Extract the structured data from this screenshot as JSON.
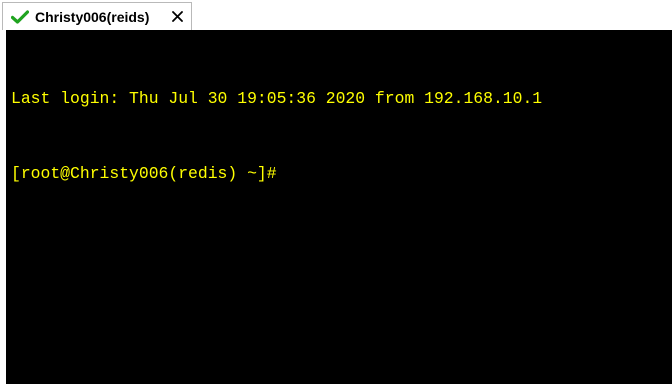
{
  "tab": {
    "title": "Christy006(reids)",
    "status_icon": "green-checkmark-icon",
    "close_icon": "close-icon"
  },
  "terminal": {
    "lines": [
      "Last login: Thu Jul 30 19:05:36 2020 from 192.168.10.1",
      "[root@Christy006(redis) ~]#"
    ],
    "text_color": "#ffff00",
    "background_color": "#000000"
  },
  "colors": {
    "check_green": "#1fa31f"
  }
}
